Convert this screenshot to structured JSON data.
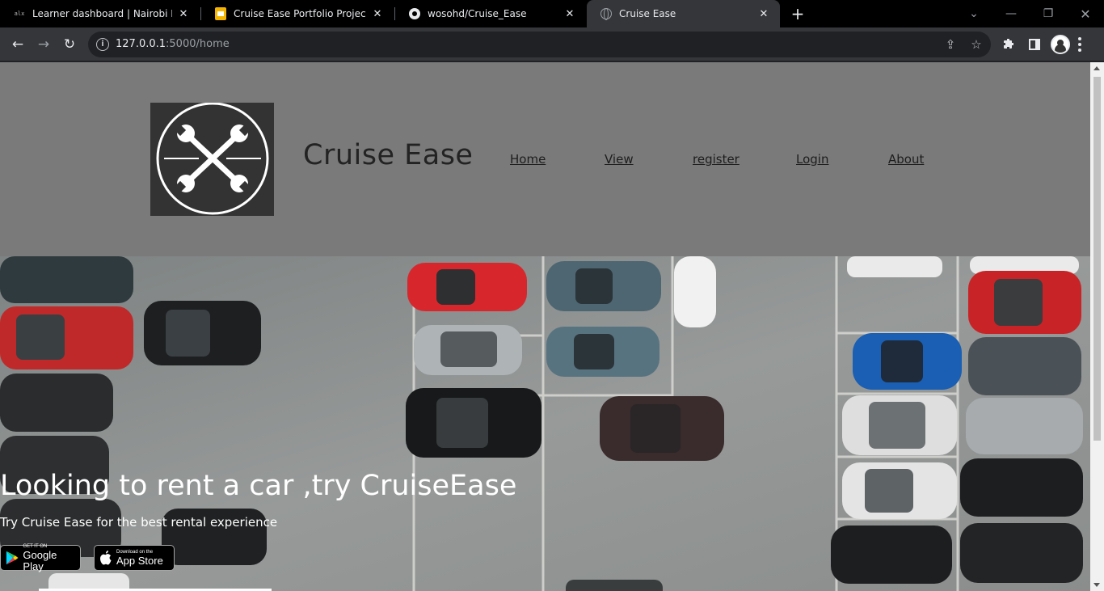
{
  "browser": {
    "tabs": [
      {
        "title": "Learner dashboard | Nairobi Intr",
        "favicon": "alx-icon",
        "active": false
      },
      {
        "title": "Cruise Ease Portfolio Project Pre",
        "favicon": "slides-icon",
        "active": false
      },
      {
        "title": "wosohd/Cruise_Ease",
        "favicon": "github-icon",
        "active": false
      },
      {
        "title": "Cruise Ease",
        "favicon": "globe-icon",
        "active": true
      }
    ],
    "favicon_text": "alx",
    "url_host": "127.0.0.1",
    "url_rest": ":5000/home"
  },
  "site": {
    "brand": "Cruise Ease",
    "nav": [
      "Home",
      "View",
      "register",
      "Login",
      "About"
    ],
    "hero_title": "Looking to rent a car ,try CruiseEase",
    "hero_subtitle": "Try Cruise Ease for the best rental experience",
    "google_play": {
      "small": "GET IT ON",
      "big": "Google Play"
    },
    "app_store": {
      "small": "Download on the",
      "big": "App Store"
    }
  },
  "colors": {
    "header_bg": "#7a7a7a",
    "logo_bg": "#333333",
    "hero_text": "#ffffff"
  }
}
